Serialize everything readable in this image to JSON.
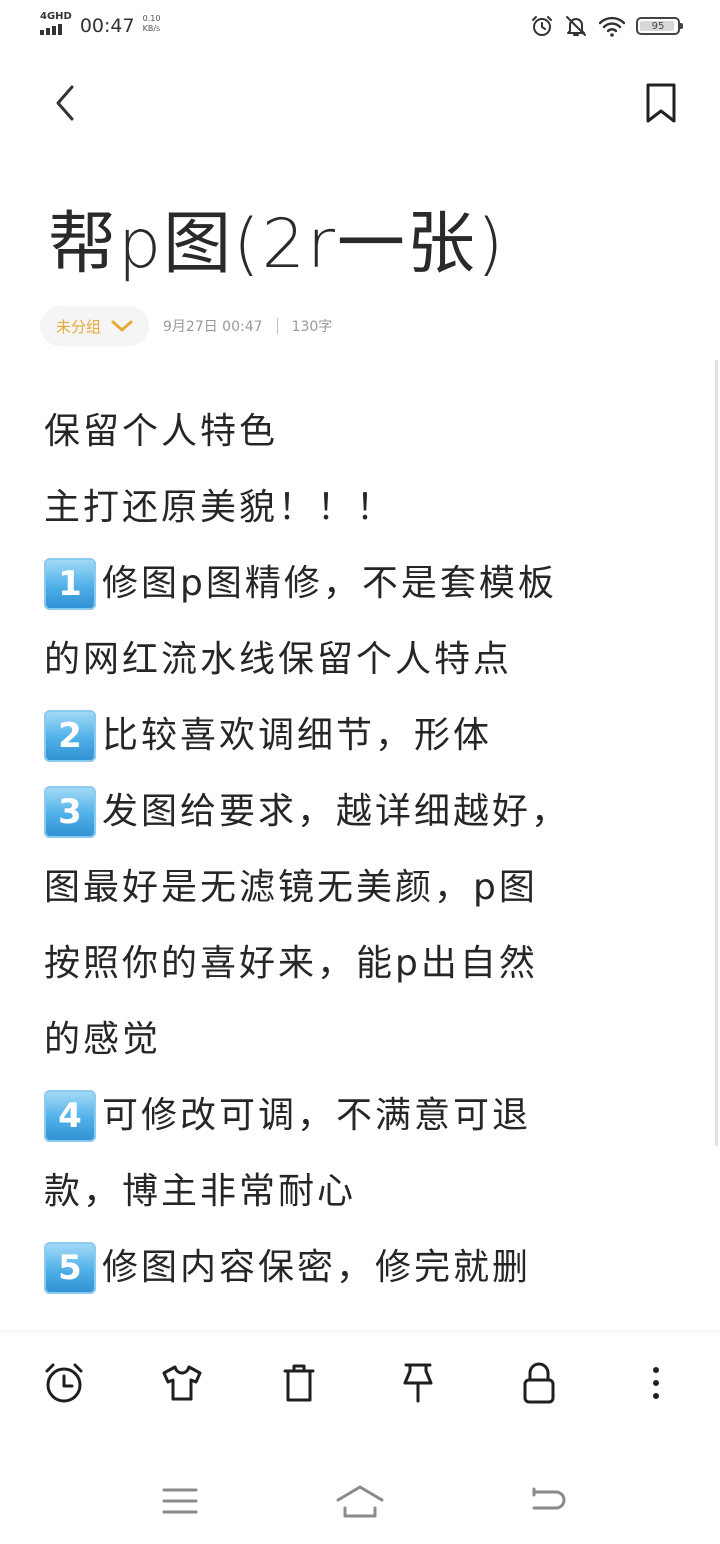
{
  "status_bar": {
    "network": "4GHD",
    "time": "00:47",
    "speed_value": "0.10",
    "speed_unit": "KB/s",
    "battery_percent": "95",
    "battery_level": 0.95,
    "icons": [
      "alarm-icon",
      "mute-bell-icon",
      "wifi-icon",
      "battery-icon"
    ]
  },
  "header": {
    "back_icon": "chevron-left-icon",
    "bookmark_icon": "bookmark-icon"
  },
  "note": {
    "title": "帮p图(2r一张)",
    "group_label": "未分组",
    "date": "9月27日 00:47",
    "word_count": "130字",
    "lines": [
      {
        "badge": "",
        "text": "保留个人特色"
      },
      {
        "badge": "",
        "text": "主打还原美貌！！！"
      },
      {
        "badge": "1",
        "text": "修图p图精修，不是套模板"
      },
      {
        "badge": "",
        "text": "的网红流水线保留个人特点"
      },
      {
        "badge": "2",
        "text": "比较喜欢调细节，形体"
      },
      {
        "badge": "3",
        "text": "发图给要求，越详细越好，"
      },
      {
        "badge": "",
        "text": "图最好是无滤镜无美颜，p图"
      },
      {
        "badge": "",
        "text": "按照你的喜好来，能p出自然"
      },
      {
        "badge": "",
        "text": "的感觉"
      },
      {
        "badge": "4",
        "text": "可修改可调，不满意可退"
      },
      {
        "badge": "",
        "text": "款，博主非常耐心"
      },
      {
        "badge": "5",
        "text": "修图内容保密，修完就删"
      }
    ]
  },
  "toolbar": {
    "items": [
      "alarm-clock-icon",
      "tshirt-icon",
      "trash-icon",
      "pin-icon",
      "lock-icon",
      "more-icon"
    ]
  },
  "navbar": {
    "items": [
      "menu-icon",
      "home-icon",
      "back-icon"
    ]
  },
  "colors": {
    "accent": "#e6a93a",
    "text": "#262626",
    "muted": "#9a9a9a",
    "chip_bg": "#f5f5f5",
    "badge_blue": "#4fb0e8"
  }
}
